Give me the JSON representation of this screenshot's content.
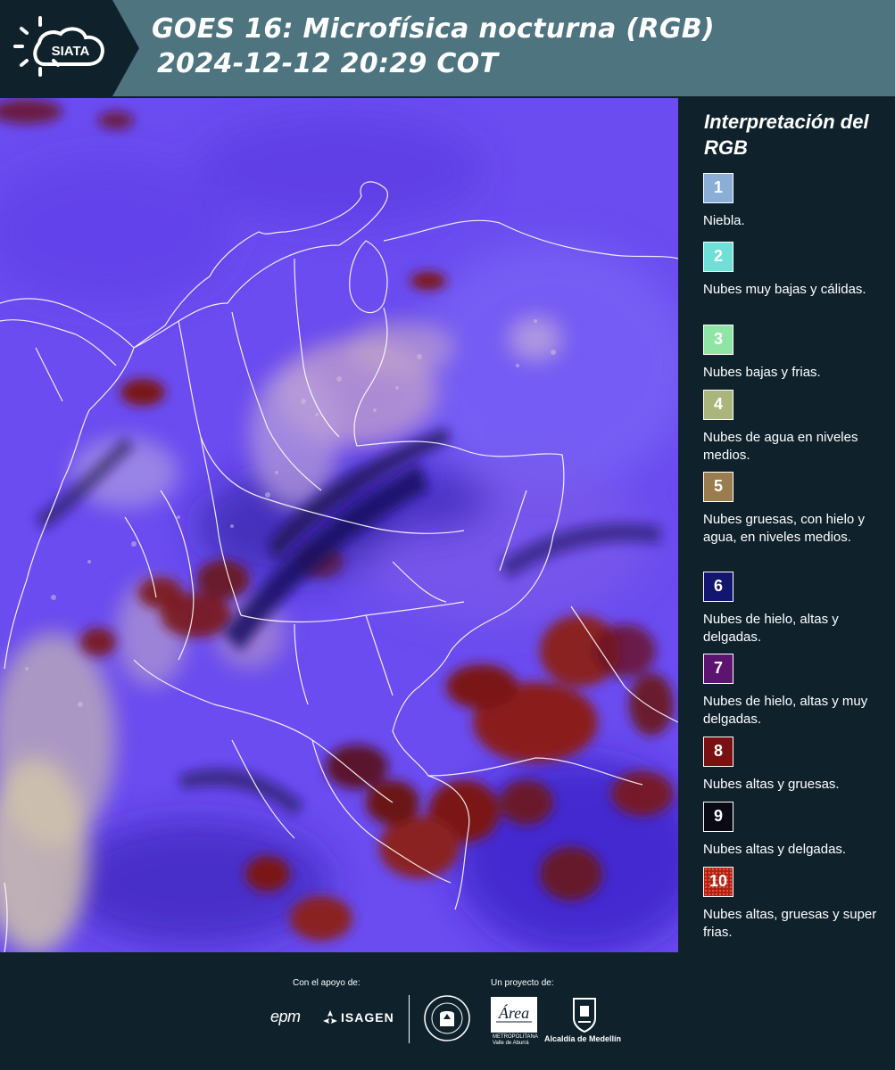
{
  "header": {
    "logo_text": "SIATA",
    "title_line1": "GOES 16: Microfísica nocturna (RGB)",
    "title_line2": "2024-12-12 20:29 COT"
  },
  "legend": {
    "title": "Interpretación del RGB",
    "items": [
      {
        "number": "1",
        "label": "Niebla.",
        "color": "#8aaed6"
      },
      {
        "number": "2",
        "label": "Nubes muy bajas y cálidas.",
        "color": "#6fe0d7"
      },
      {
        "number": "3",
        "label": "Nubes bajas y frias.",
        "color": "#8fe6a4"
      },
      {
        "number": "4",
        "label": "Nubes de agua en niveles medios.",
        "color": "#a9b57a"
      },
      {
        "number": "5",
        "label": "Nubes gruesas, con hielo y agua, en niveles medios.",
        "color": "#9a7d4e"
      },
      {
        "number": "6",
        "label": "Nubes de hielo, altas y delgadas.",
        "color": "#13166e"
      },
      {
        "number": "7",
        "label": "Nubes de hielo, altas y muy delgadas.",
        "color": "#5d1470"
      },
      {
        "number": "8",
        "label": "Nubes altas y gruesas.",
        "color": "#7a1010"
      },
      {
        "number": "9",
        "label": "Nubes altas y delgadas.",
        "color": "#0a0a16"
      },
      {
        "number": "10",
        "label": "Nubes altas, gruesas y super frias.",
        "color": "#b01e14"
      }
    ]
  },
  "footer": {
    "support_label": "Con el apoyo de:",
    "project_label": "Un proyecto de:",
    "epm_logo": "epm",
    "isagen_logo": "ISAGEN",
    "area_logo": "Área",
    "area_subtitle": "METROPOLITANA Valle de Aburrá",
    "alcaldia_logo": "Alcaldía de Medellín"
  },
  "map": {
    "base_color": "#6a4cf0",
    "cloud_high_thick_color": "#8a1e1e",
    "cloud_low_color": "#c9a6c9"
  }
}
